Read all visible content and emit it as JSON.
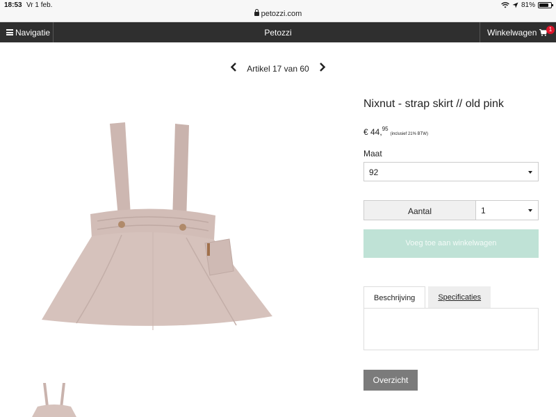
{
  "status_bar": {
    "time": "18:53",
    "date": "Vr 1 feb.",
    "battery": "81%",
    "battery_level": 0.81
  },
  "browser": {
    "url": "petozzi.com"
  },
  "nav": {
    "menu_label": "Navigatie",
    "site_title": "Petozzi",
    "cart_label": "Winkelwagen",
    "cart_count": "1"
  },
  "pager": {
    "label": "Artikel 17 van 60"
  },
  "product": {
    "title": "Nixnut - strap skirt // old pink",
    "price_main": "€ 44,",
    "price_cents": "95",
    "price_vat": "(inclusief 21% BTW)",
    "size_label": "Maat",
    "size_value": "92",
    "qty_label": "Aantal",
    "qty_value": "1",
    "add_to_cart": "Voeg toe aan winkelwagen",
    "tabs": [
      {
        "label": "Beschrijving",
        "active": true
      },
      {
        "label": "Specificaties",
        "active": false
      }
    ],
    "overview_button": "Overzicht"
  },
  "colors": {
    "navbar": "#2f2f2f",
    "add_to_cart_bg": "#bfe2d6",
    "cart_badge": "#e0142a",
    "skirt": "#d4bfb9",
    "overview_bg": "#7b7b7b"
  }
}
